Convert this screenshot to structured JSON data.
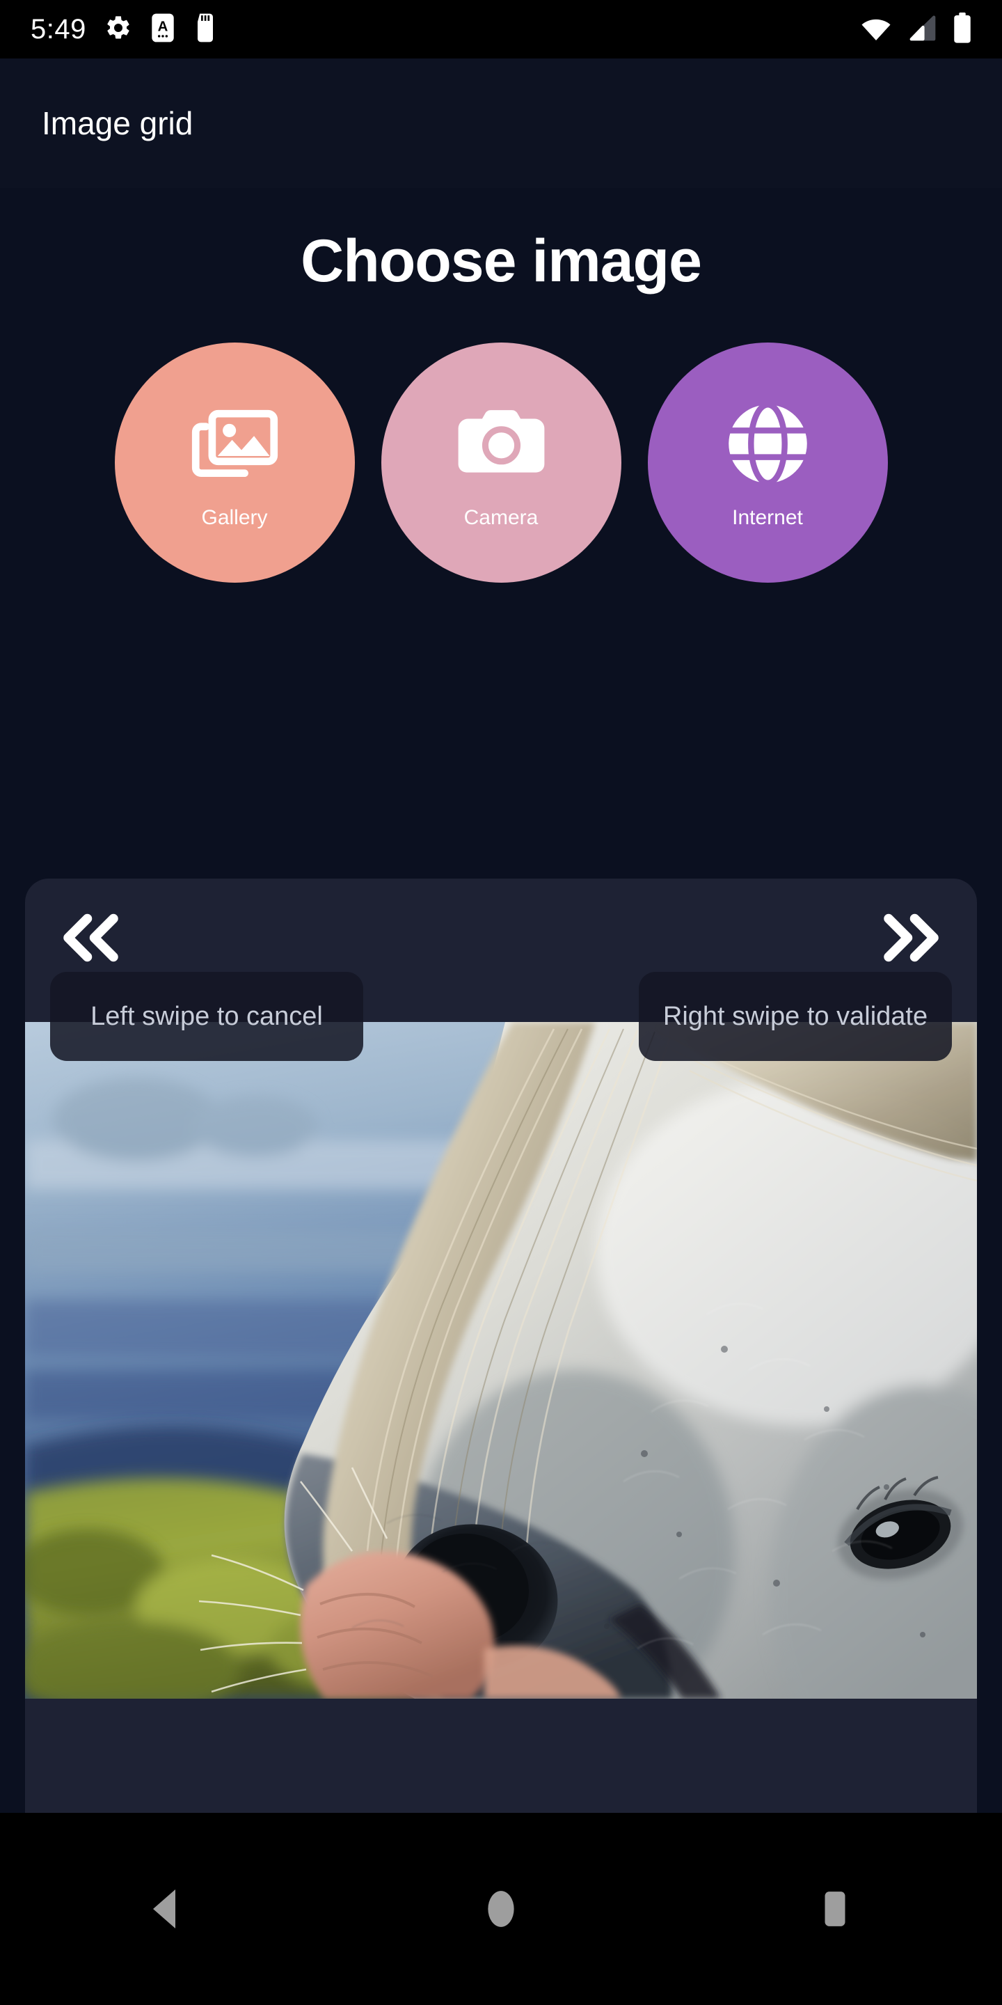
{
  "status_bar": {
    "time": "5:49",
    "left_icons": [
      "settings-gear-icon",
      "android-auto-icon",
      "sd-card-icon"
    ],
    "right_icons": [
      "wifi-icon",
      "cellular-signal-icon",
      "battery-icon"
    ],
    "background": "#000000"
  },
  "app_bar": {
    "title": "Image grid",
    "background": "#0d1222"
  },
  "page": {
    "heading": "Choose image",
    "background": "#0b1020"
  },
  "sources": [
    {
      "label": "Gallery",
      "icon": "photo-library-icon",
      "color": "#f0a08f"
    },
    {
      "label": "Camera",
      "icon": "camera-icon",
      "color": "#dfa7b8"
    },
    {
      "label": "Internet",
      "icon": "globe-icon",
      "color": "#9b5ec0"
    }
  ],
  "swipe_card": {
    "background": "#1e2234",
    "left_chevron_icon": "chevron-double-left-icon",
    "right_chevron_icon": "chevron-double-right-icon",
    "left_hint": "Left swipe to cancel",
    "right_hint": "Right swipe to validate",
    "photo_alt": "white horse close-up portrait in green field under blue sky"
  },
  "nav_bar": {
    "back": "back-triangle-icon",
    "home": "home-circle-icon",
    "recents": "recents-square-icon",
    "background": "#000000"
  }
}
